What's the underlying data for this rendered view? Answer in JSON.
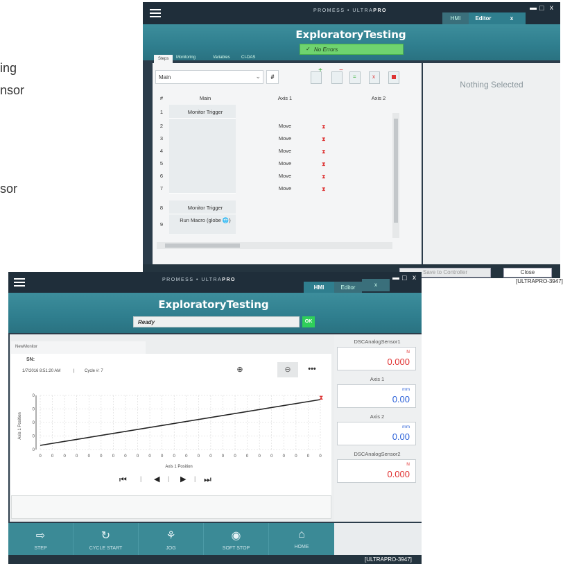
{
  "background_text": [
    "ing",
    "nsor",
    "sor"
  ],
  "editor_window": {
    "brand": "PROMESS • ULTRA",
    "brand_bold": "PRO",
    "tabs": [
      "HMI",
      "Editor"
    ],
    "close_tab": "x",
    "title": "ExploratoryTesting",
    "status": "No Errors",
    "sub_tabs": [
      "Steps",
      "Monitoring",
      "Variables",
      "CI-DAS"
    ],
    "dropdown_value": "Main",
    "hash_button": "#",
    "columns": [
      "#",
      "Main",
      "Axis 1",
      "Axis 2"
    ],
    "rows": [
      {
        "num": "1",
        "main": "Monitor Trigger",
        "axis1": ""
      },
      {
        "num": "2",
        "main": "",
        "axis1": "Move"
      },
      {
        "num": "3",
        "main": "",
        "axis1": "Move"
      },
      {
        "num": "4",
        "main": "",
        "axis1": "Move"
      },
      {
        "num": "5",
        "main": "",
        "axis1": "Move"
      },
      {
        "num": "6",
        "main": "",
        "axis1": "Move"
      },
      {
        "num": "7",
        "main": "",
        "axis1": "Move"
      },
      {
        "num": "8",
        "main": "Monitor Trigger",
        "axis1": ""
      },
      {
        "num": "9",
        "main": "Run Macro (globe 🌐)",
        "axis1": ""
      }
    ],
    "nothing_selected": "Nothing Selected",
    "save_button": "Save to Controller",
    "close_button": "Close",
    "id_label": "[ULTRAPRO-3947]"
  },
  "hmi_window": {
    "brand": "PROMESS • ULTRA",
    "brand_bold": "PRO",
    "tabs": [
      "HMI",
      "Editor"
    ],
    "close_tab": "x",
    "title": "ExploratoryTesting",
    "status": "Ready",
    "ok_button": "OK",
    "monitor_tab": "NewMonitor",
    "sn_label": "SN:",
    "timestamp": "1/7/2016 8:51:20 AM",
    "cycle": "Cycle #: 7",
    "x_axis_label": "Axis 1 Position",
    "y_axis_label": "Axis 1 Position",
    "x_ticks": [
      "0",
      "0",
      "0",
      "0",
      "0",
      "0",
      "0",
      "0",
      "0",
      "0",
      "0",
      "0",
      "0",
      "0",
      "0",
      "0",
      "0",
      "0",
      "0",
      "0",
      "0",
      "0",
      "0",
      "0"
    ],
    "y_ticks": [
      "0",
      "0",
      "0",
      "0",
      "0"
    ],
    "sensors": [
      {
        "label": "DSCAnalogSensor1",
        "unit": "N",
        "value": "0.000",
        "color": "#e03030"
      },
      {
        "label": "Axis 1",
        "unit": "mm",
        "value": "0.00",
        "color": "#2a60d8"
      },
      {
        "label": "Axis 2",
        "unit": "mm",
        "value": "0.00",
        "color": "#2a60d8"
      },
      {
        "label": "DSCAnalogSensor2",
        "unit": "N",
        "value": "0.000",
        "color": "#e03030"
      }
    ],
    "bottom_buttons": [
      "STEP",
      "CYCLE START",
      "JOG",
      "SOFT STOP",
      "HOME"
    ],
    "id_label": "[ULTRAPRO-3947]"
  }
}
